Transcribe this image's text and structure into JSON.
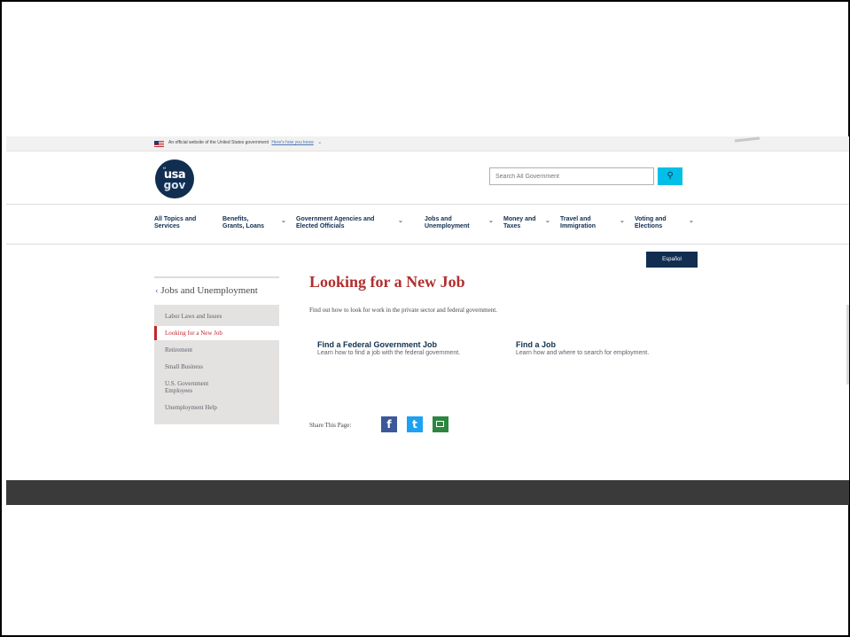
{
  "banner": {
    "text": "An official website of the United States government",
    "link": "Here's how you know",
    "chevron_icon": "chevron-down-icon"
  },
  "logo": {
    "line1": "usa",
    "line2": "gov",
    "mark": "“"
  },
  "search": {
    "placeholder": "Search All Government",
    "button_icon": "search-icon",
    "button_glyph": "⚲"
  },
  "nav": {
    "caret": "⌄",
    "items": [
      {
        "line1": "All Topics and",
        "line2": "Services"
      },
      {
        "line1": "Benefits,",
        "line2": "Grants, Loans"
      },
      {
        "line1": "Government Agencies and",
        "line2": "Elected Officials"
      },
      {
        "line1": "Jobs and",
        "line2": "Unemployment"
      },
      {
        "line1": "Money and",
        "line2": "Taxes"
      },
      {
        "line1": "Travel and",
        "line2": "Immigration"
      },
      {
        "line1": "Voting and",
        "line2": "Elections"
      }
    ]
  },
  "language_button": "Español",
  "sidebar": {
    "back_arrow": "‹",
    "title": "Jobs and Unemployment",
    "items": [
      {
        "label": "Labor Laws and Issues",
        "active": false
      },
      {
        "label": "Looking for a New Job",
        "active": true
      },
      {
        "label": "Retirement",
        "active": false
      },
      {
        "label": "Small Business",
        "active": false
      },
      {
        "label": "U.S. Government Employees",
        "active": false
      },
      {
        "label": "Unemployment Help",
        "active": false
      }
    ]
  },
  "main": {
    "title": "Looking for a New Job",
    "intro": "Find out how to look for work in the private sector and federal government.",
    "cards": [
      {
        "title": "Find a Federal Government Job",
        "desc": "Learn how to find a job with the federal government."
      },
      {
        "title": "Find a Job",
        "desc": "Learn how and where to search for employment."
      }
    ]
  },
  "share": {
    "label": "Share This Page:",
    "icons": [
      {
        "name": "facebook-icon",
        "glyph": "f",
        "color": "#3b5998"
      },
      {
        "name": "twitter-icon",
        "glyph": "t",
        "color": "#1da1f2"
      },
      {
        "name": "email-icon",
        "glyph": "",
        "color": "#2e8540"
      }
    ]
  },
  "colors": {
    "navy": "#112e51",
    "title_red": "#b12f2f",
    "active_red": "#c1272d",
    "search_cyan": "#02bfe7",
    "sidebar_bg": "#e4e2e0",
    "footer": "#3a3a3a"
  }
}
